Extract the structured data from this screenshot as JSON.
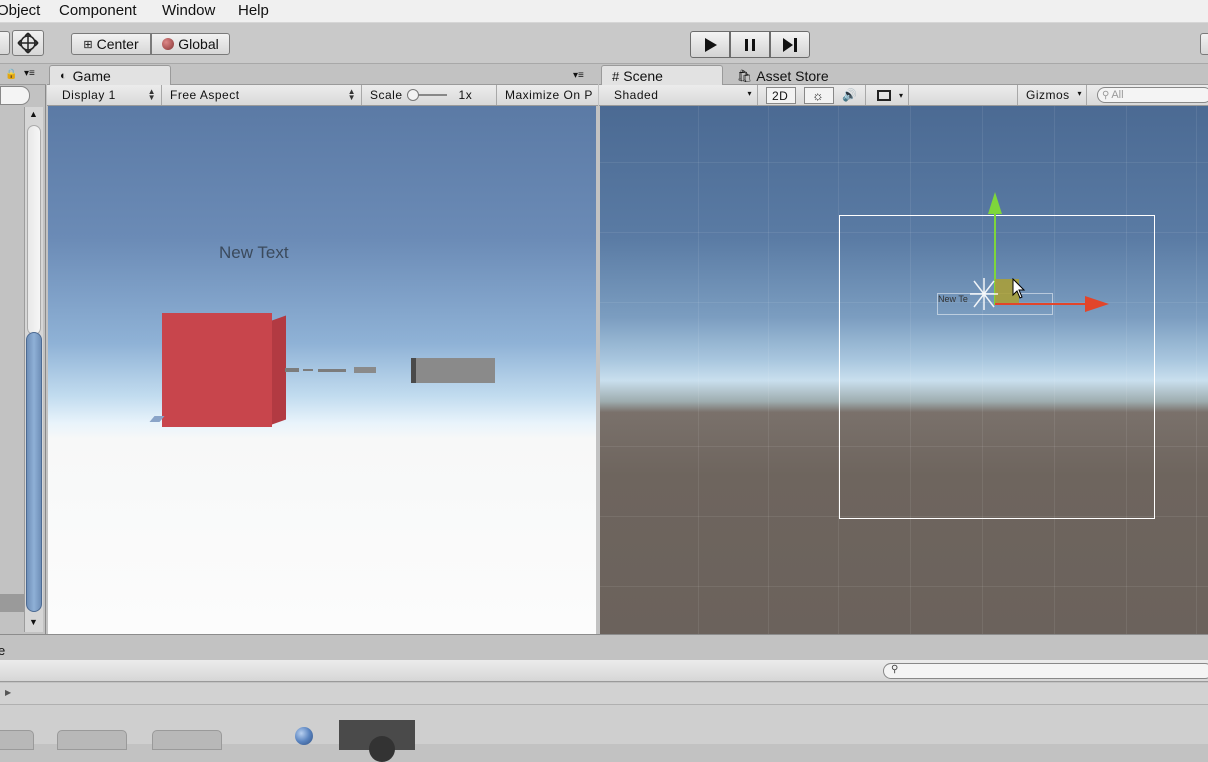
{
  "menu": {
    "items": [
      "Object",
      "Component",
      "Window",
      "Help"
    ]
  },
  "toolbar": {
    "center_label": "Center",
    "global_label": "Global"
  },
  "game_panel": {
    "tab_label": "Game",
    "display_label": "Display 1",
    "aspect_label": "Free Aspect",
    "scale_label": "Scale",
    "scale_value": "1x",
    "maximize_label": "Maximize On P",
    "world_text": "New Text"
  },
  "scene_panel": {
    "tab_label": "Scene",
    "asset_store_label": "Asset Store",
    "shading_label": "Shaded",
    "twod_label": "2D",
    "gizmos_label": "Gizmos",
    "search_placeholder": "All",
    "object_label": "New Te"
  },
  "bottom": {
    "panel_label_fragment": "e"
  },
  "colors": {
    "cube_red": "#c8454c",
    "x_axis": "#e2452a",
    "y_axis": "#7ed63b",
    "selection_box": "#ffffff"
  }
}
